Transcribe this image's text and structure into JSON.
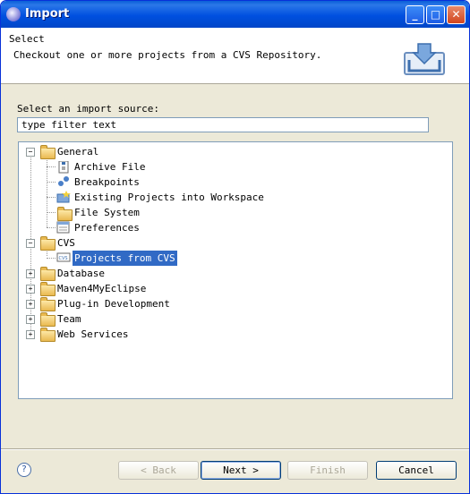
{
  "window": {
    "title": "Import"
  },
  "header": {
    "title": "Select",
    "description": "Checkout one or more projects from a CVS Repository."
  },
  "source": {
    "label": "Select an import source:",
    "filter_value": "type filter text"
  },
  "tree": {
    "general": {
      "label": "General",
      "expander": "−"
    },
    "archive": {
      "label": "Archive File"
    },
    "breakpoints": {
      "label": "Breakpoints"
    },
    "existing": {
      "label": "Existing Projects into Workspace"
    },
    "filesystem": {
      "label": "File System"
    },
    "preferences": {
      "label": "Preferences"
    },
    "cvs": {
      "label": "CVS",
      "expander": "−"
    },
    "projects_cvs": {
      "label": "Projects from CVS"
    },
    "database": {
      "label": "Database",
      "expander": "+"
    },
    "maven": {
      "label": "Maven4MyEclipse",
      "expander": "+"
    },
    "plugin": {
      "label": "Plug-in Development",
      "expander": "+"
    },
    "team": {
      "label": "Team",
      "expander": "+"
    },
    "web": {
      "label": "Web Services",
      "expander": "+"
    }
  },
  "buttons": {
    "back": "< Back",
    "next": "Next >",
    "finish": "Finish",
    "cancel": "Cancel",
    "help": "?"
  },
  "titlebar_buttons": {
    "minimize": "_",
    "maximize": "□",
    "close": "✕"
  },
  "colors": {
    "selection": "#316ac5",
    "titlebar": "#0050e0"
  }
}
